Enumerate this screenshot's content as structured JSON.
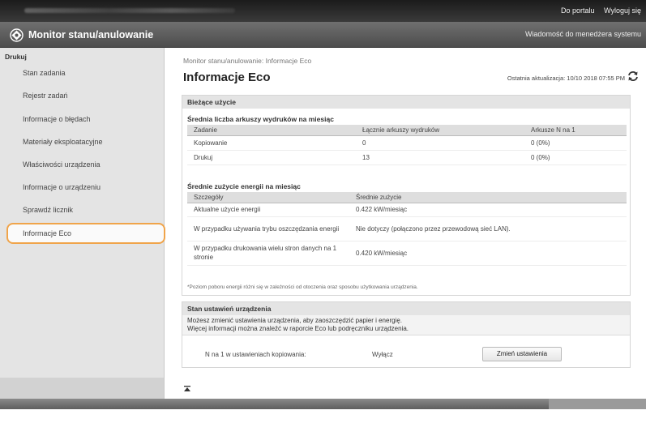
{
  "topbar": {
    "links": [
      "Do portalu",
      "Wyloguj się"
    ]
  },
  "header": {
    "title": "Monitor stanu/anulowanie",
    "message_link": "Wiadomość do menedżera systemu"
  },
  "sidebar": {
    "section": "Drukuj",
    "items": [
      "Stan zadania",
      "Rejestr zadań",
      "Informacje o błędach",
      "Materiały eksploatacyjne",
      "Właściwości urządzenia",
      "Informacje o urządzeniu",
      "Sprawdź licznik",
      "Informacje Eco"
    ],
    "active_index": 7
  },
  "main": {
    "breadcrumb": "Monitor stanu/anulowanie: Informacje Eco",
    "title": "Informacje Eco",
    "last_update": "Ostatnia aktualizacja: 10/10 2018 07:55 PM",
    "current_usage": {
      "header": "Bieżące użycie",
      "prints": {
        "title": "Średnia liczba arkuszy wydruków na miesiąc",
        "columns": [
          "Zadanie",
          "Łącznie arkuszy wydruków",
          "Arkusze N na 1"
        ],
        "rows": [
          [
            "Kopiowanie",
            "0",
            "0 (0%)"
          ],
          [
            "Drukuj",
            "13",
            "0 (0%)"
          ]
        ]
      },
      "energy": {
        "title": "Średnie zużycie energii na miesiąc",
        "columns": [
          "Szczegóły",
          "Średnie zużycie"
        ],
        "rows": [
          [
            "Aktualne użycie energii",
            "0.422  kW/miesiąc"
          ],
          [
            "W przypadku używania trybu oszczędzania energii",
            "Nie dotyczy (połączono przez przewodową sieć LAN)."
          ],
          [
            "W przypadku drukowania wielu stron danych na 1 stronie",
            "0.420  kW/miesiąc"
          ]
        ],
        "note": "*Poziom poboru energii różni się w zależności od otoczenia oraz sposobu użytkowania urządzenia."
      }
    },
    "eco_settings": {
      "header": "Stan ustawień urządzenia",
      "text_line1": "Możesz zmienić ustawienia urządzenia, aby zaoszczędzić papier i energię.",
      "text_line2": "Więcej informacji można znaleźć w raporcie Eco lub podręczniku urządzenia.",
      "setting_label": "N na 1 w ustawieniach kopiowania:",
      "setting_value": "Wyłącz",
      "change_button": "Zmień ustawienia"
    }
  },
  "colors": {
    "active_outline": "#f0a44a",
    "header_bg": "#5a5a5a"
  },
  "icons": {
    "logo": "canon-logo-icon",
    "refresh": "refresh-icon",
    "totop": "back-to-top-icon"
  }
}
